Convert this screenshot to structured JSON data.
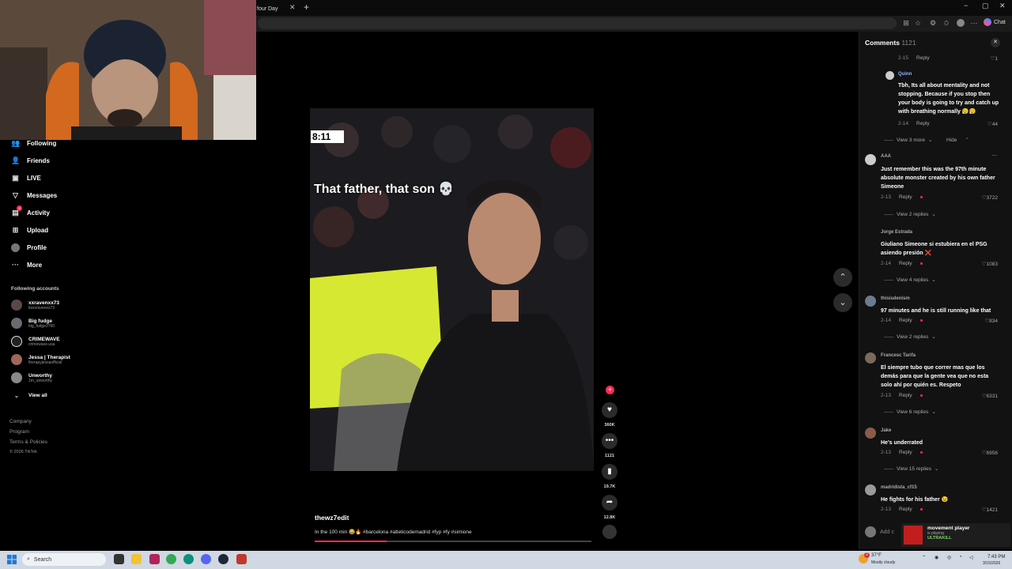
{
  "browser": {
    "tab_title": "four Day",
    "tab_close": "✕",
    "new_tab": "+",
    "chat_label": "Chat",
    "win_min": "−",
    "win_max": "▢",
    "win_close": "✕"
  },
  "sidebar": {
    "items": [
      {
        "label": "Following",
        "icon": "following-icon",
        "glyph": "👥"
      },
      {
        "label": "Friends",
        "icon": "friends-icon",
        "glyph": "👤"
      },
      {
        "label": "LIVE",
        "icon": "live-icon",
        "glyph": "▣"
      },
      {
        "label": "Messages",
        "icon": "messages-icon",
        "glyph": "▽"
      },
      {
        "label": "Activity",
        "icon": "activity-icon",
        "glyph": "▤"
      },
      {
        "label": "Upload",
        "icon": "upload-icon",
        "glyph": "⊞"
      },
      {
        "label": "Profile",
        "icon": "profile-icon",
        "glyph": "●"
      },
      {
        "label": "More",
        "icon": "more-icon",
        "glyph": "···"
      }
    ],
    "activity_badge": "3",
    "following_heading": "Following accounts",
    "accounts": [
      {
        "name": "xxravenxx73",
        "handle": "itsxxravenxx73"
      },
      {
        "name": "Big fudge",
        "handle": "big_fudge2760"
      },
      {
        "name": "CRIMEWAVE",
        "handle": "crimewave.usa"
      },
      {
        "name": "Jessa | Therapist",
        "handle": "therapyjessaofficial"
      },
      {
        "name": "Unworthy",
        "handle": "1m_unworthy"
      }
    ],
    "view_all": "View all",
    "footer": [
      "Company",
      "Program",
      "Terms & Policies"
    ],
    "copyright": "© 2026 TikTok"
  },
  "video": {
    "timer": "8:11",
    "caption": "That father, that son 💀",
    "author": "thewz7edit",
    "description": "In the 100 min 😂🔥 #barcelona #atleticodemadrid #fyp #fy #simione",
    "progress": 0.26
  },
  "actions": {
    "follow": "+",
    "likes": "360K",
    "comments": "1121",
    "saves": "19.7K",
    "shares": "12.8K"
  },
  "comments": {
    "title": "Comments",
    "count": "1121",
    "close": "✕",
    "items": [
      {
        "type": "meta",
        "time": "2-15",
        "reply": "Reply",
        "likes": "1"
      },
      {
        "type": "comment",
        "user": "Quinn",
        "text": "Tbh, Its all about mentality and not stopping. Because if you stop then your body is going to try and catch up with breathing normally 😮‍💨😮‍💨",
        "time": "2-14",
        "reply": "Reply",
        "likes": "44",
        "more": "View 3 more",
        "hide": "Hide"
      },
      {
        "type": "comment",
        "user": "AAA",
        "text": "Just remember this was the 97th minute absolute monster created by his own father Simeone",
        "time": "2-13",
        "reply": "Reply",
        "likes": "3722",
        "more": "View 2 replies"
      },
      {
        "type": "comment",
        "user": "Jorge Estrada",
        "text": "Giuliano Simeone si estubiera en el PSG asiendo presión ❌",
        "time": "2-14",
        "reply": "Reply",
        "likes": "1083",
        "more": "View 4 replies"
      },
      {
        "type": "comment",
        "user": "thisisdenism",
        "text": "97 minutes and he is still running like that",
        "time": "2-14",
        "reply": "Reply",
        "likes": "834",
        "more": "View 2 replies"
      },
      {
        "type": "comment",
        "user": "Francesc Tarifa",
        "text": "El siempre tubo que correr mas que los demás para que la gente vea que no esta solo ahí por quién es. Respeto",
        "time": "2-13",
        "reply": "Reply",
        "likes": "6331",
        "more": "View 6 replies"
      },
      {
        "type": "comment",
        "user": "Jake",
        "text": "He's underrated",
        "time": "2-13",
        "reply": "Reply",
        "likes": "6956",
        "more": "View 15 replies"
      },
      {
        "type": "comment",
        "user": "madridista_cf15",
        "text": "He fights for his father 😉",
        "time": "2-13",
        "reply": "Reply",
        "likes": "1421"
      }
    ],
    "add_placeholder": "Add c"
  },
  "notification": {
    "title": "movement player",
    "status": "is playing",
    "game": "ULTRAKILL"
  },
  "taskbar": {
    "search_label": "Search",
    "weather_temp": "37°F",
    "weather_desc": "Mostly cloudy",
    "time": "7:43 PM",
    "date": "3/15/2026",
    "weather_badge": "2"
  }
}
